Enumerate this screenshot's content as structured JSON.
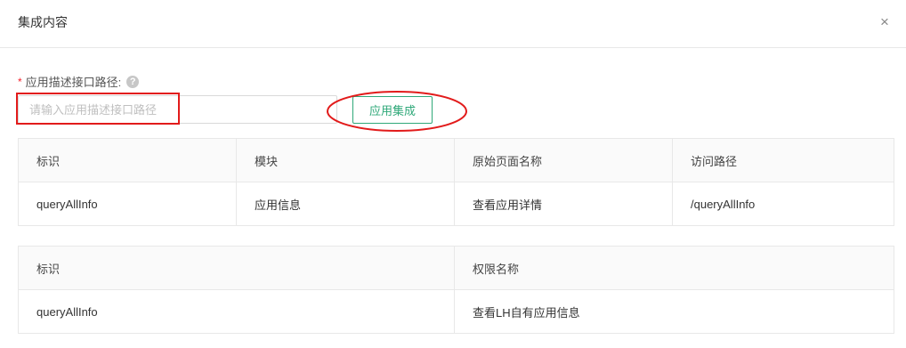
{
  "dialog": {
    "title": "集成内容",
    "close_icon": "close-icon",
    "close_glyph": "×"
  },
  "form": {
    "required_mark": "*",
    "label": "应用描述接口路径:",
    "help_icon": "question-circle-icon",
    "help_glyph": "?",
    "input_placeholder": "请输入应用描述接口路径",
    "input_value": "",
    "submit_label": "应用集成"
  },
  "annotations": {
    "color": "#e21b1b"
  },
  "pages_table": {
    "columns": [
      "标识",
      "模块",
      "原始页面名称",
      "访问路径"
    ],
    "rows": [
      [
        "queryAllInfo",
        "应用信息",
        "查看应用详情",
        "/queryAllInfo"
      ]
    ]
  },
  "permissions_table": {
    "columns": [
      "标识",
      "权限名称"
    ],
    "rows": [
      [
        "queryAllInfo",
        "查看LH自有应用信息"
      ]
    ]
  },
  "colors": {
    "accent": "#2fa879",
    "required": "#f5222d",
    "border": "#e8e8e8",
    "header_bg": "#fafafa"
  }
}
